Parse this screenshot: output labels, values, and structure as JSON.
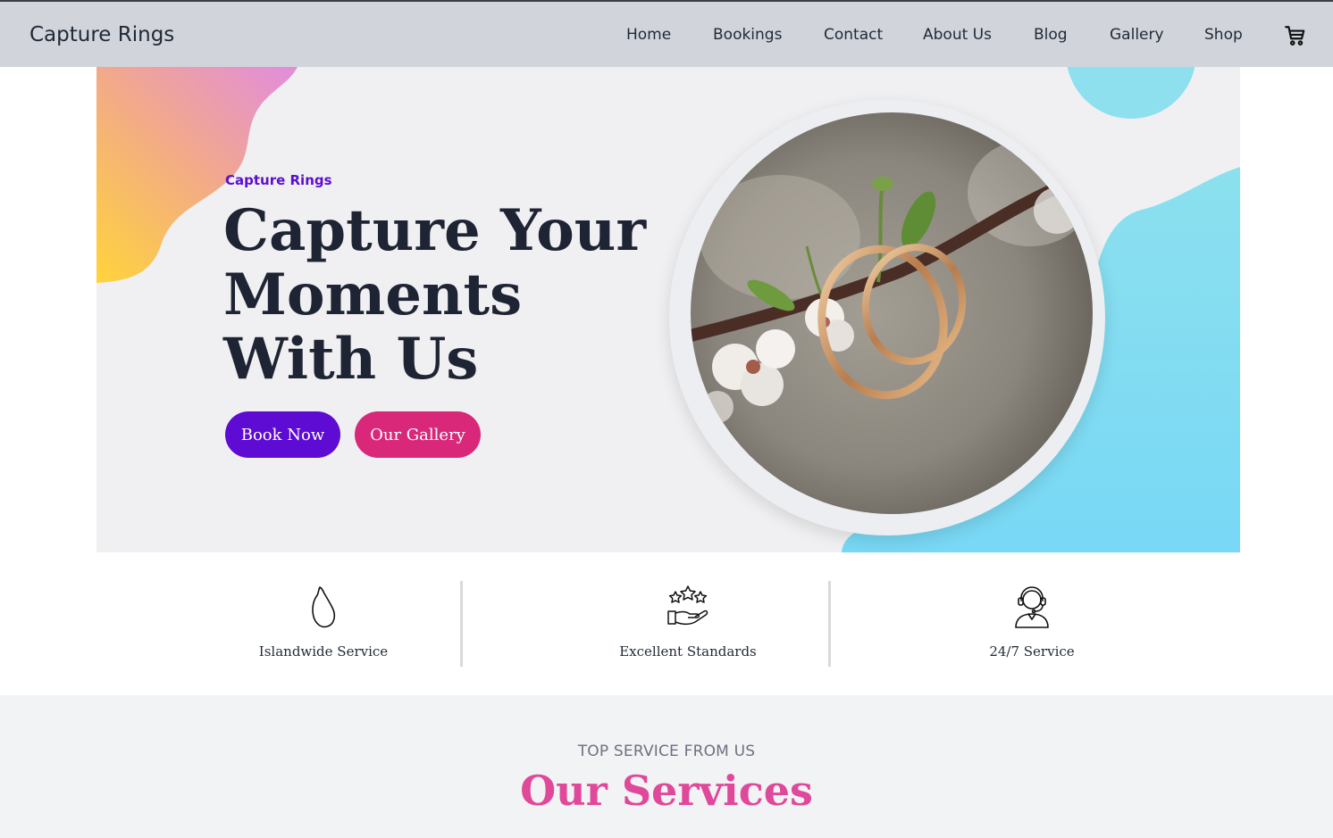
{
  "nav": {
    "brand": "Capture Rings",
    "links": [
      "Home",
      "Bookings",
      "Contact",
      "About Us",
      "Blog",
      "Gallery",
      "Shop"
    ],
    "cart_icon": "cart-icon"
  },
  "hero": {
    "eyebrow": "Capture Rings",
    "headline": "Capture Your Moments With Us",
    "book_button": "Book Now",
    "gallery_button": "Our Gallery",
    "image_subject": "wedding rings on a blossom branch"
  },
  "features": [
    {
      "label": "Islandwide Service",
      "icon": "sri-lanka-map-icon"
    },
    {
      "label": "Excellent Standards",
      "icon": "stars-hand-icon"
    },
    {
      "label": "24/7 Service",
      "icon": "support-agent-icon"
    }
  ],
  "services": {
    "subtitle": "TOP SERVICE FROM US",
    "title": "Our Services"
  },
  "colors": {
    "navbar": "#d1d5db",
    "primary_purple": "#5e0bd4",
    "accent_pink": "#d9287a",
    "title_pink": "#e0489a",
    "cyan_blob": "#80dcf2"
  }
}
